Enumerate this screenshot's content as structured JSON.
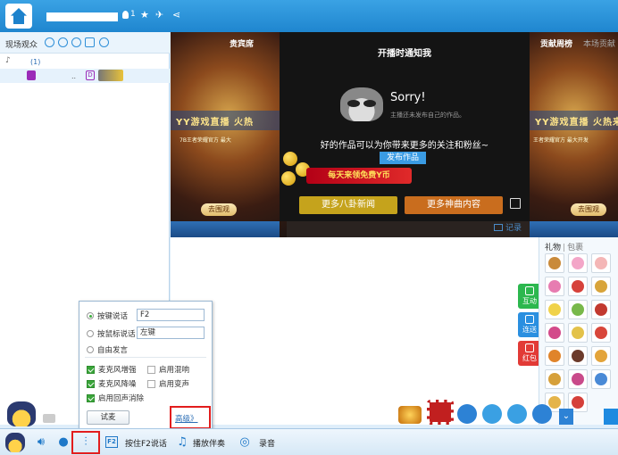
{
  "topbar": {
    "user_count": "1"
  },
  "left_panel": {
    "audience_label": "现场观众",
    "tree_count": "(1)"
  },
  "stage": {
    "poster_left_tab": "贵宾席",
    "poster_right_tab": "贡献周榜",
    "poster_right_tab2": "本场贡献",
    "poster_banner_left": "YY游戏直播 火热",
    "poster_banner_right": "YY游戏直播 火热来袭",
    "poster_sub_left": "7B王者荣耀官方 最大",
    "poster_sub_right": "王者荣耀官方 最大开发",
    "go_watch_left": "去围观",
    "go_watch_right": "去围观",
    "notify": {
      "title": "开播时通知我",
      "sorry": "Sorry!",
      "sorry_sub": "主播还未发布自己的作品。",
      "message": "好的作品可以为你带来更多的关注和粉丝~",
      "publish_tag": "发布作品",
      "promo": "每天来领免费Y币",
      "more_gossip": "更多八卦新闻",
      "more_songs": "更多神曲内容"
    }
  },
  "chat": {
    "record_label": "记录"
  },
  "gift_panel": {
    "tab_gifts": "礼物",
    "tab_bag": "包裹",
    "side_tabs": [
      "互动",
      "连送",
      "红包"
    ],
    "send_label": "赠"
  },
  "settings_popup": {
    "press_to_talk_label": "按键说话",
    "press_to_talk_key": "F2",
    "mouse_talk_label": "按鼠标说话",
    "mouse_talk_key": "左键",
    "free_talk_label": "自由发言",
    "mic_enhance": "麦克风增强",
    "enable_mix": "启用混响",
    "mic_denoise": "麦克风降噪",
    "enable_voice_change": "启用变声",
    "enable_echo_cancel": "启用回声消除",
    "test_mic": "试麦",
    "advanced": "高级》",
    "colors": {
      "highlight": "#e21d1d",
      "check_green": "#3aa53a"
    }
  },
  "bottom_bar": {
    "f2_key": "F2",
    "press_f2_label": "按住F2说话",
    "accompaniment_label": "播放伴奏",
    "record_label": "录音"
  }
}
